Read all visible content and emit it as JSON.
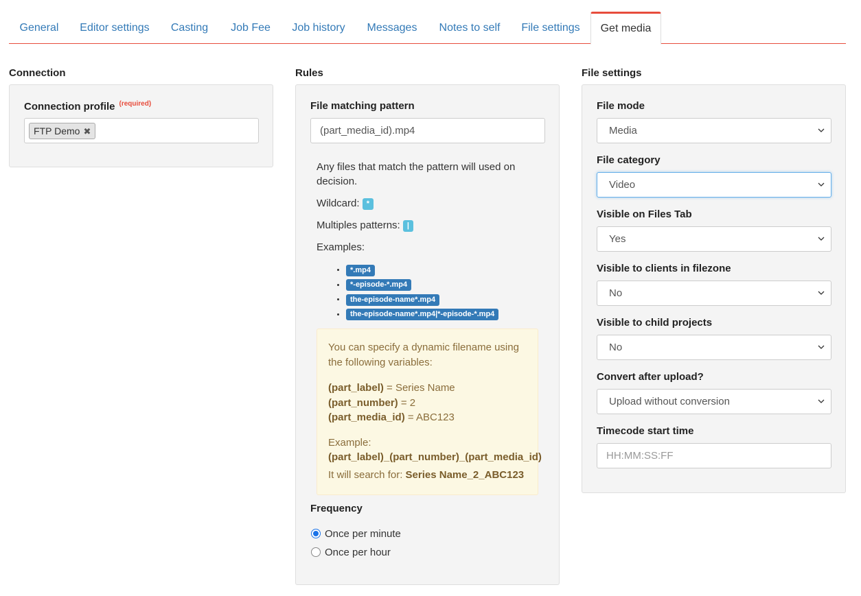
{
  "tabs": [
    {
      "label": "General"
    },
    {
      "label": "Editor settings"
    },
    {
      "label": "Casting"
    },
    {
      "label": "Job Fee"
    },
    {
      "label": "Job history"
    },
    {
      "label": "Messages"
    },
    {
      "label": "Notes to self"
    },
    {
      "label": "File settings"
    },
    {
      "label": "Get media",
      "active": true
    }
  ],
  "connection": {
    "title": "Connection",
    "profile_label": "Connection profile",
    "required": "(required)",
    "selected_tag": "FTP Demo",
    "remove_glyph": "✖"
  },
  "rules": {
    "title": "Rules",
    "pattern_label": "File matching pattern",
    "pattern_value": "(part_media_id).mp4",
    "help_line1": "Any files that match the pattern will used on decision.",
    "wildcard_label": "Wildcard:",
    "wildcard_value": "*",
    "multiple_label": "Multiples patterns:",
    "multiple_value": "|",
    "examples_label": "Examples:",
    "examples": [
      "*.mp4",
      "*-episode-*.mp4",
      "the-episode-name*.mp4",
      "the-episode-name*.mp4|*-episode-*.mp4"
    ],
    "note": {
      "intro": "You can specify a dynamic filename using the following variables:",
      "vars": [
        {
          "name": "(part_label)",
          "value": " = Series Name"
        },
        {
          "name": "(part_number)",
          "value": " = 2"
        },
        {
          "name": "(part_media_id)",
          "value": " = ABC123"
        }
      ],
      "example_label": "Example:",
      "example_value": "(part_label)_(part_number)_(part_media_id)",
      "search_label": "It will search for: ",
      "search_value": "Series Name_2_ABC123"
    },
    "frequency_label": "Frequency",
    "frequency_options": [
      {
        "label": "Once per minute",
        "checked": true
      },
      {
        "label": "Once per hour",
        "checked": false
      }
    ]
  },
  "file_settings": {
    "title": "File settings",
    "fields": [
      {
        "label": "File mode",
        "value": "Media"
      },
      {
        "label": "File category",
        "value": "Video"
      },
      {
        "label": "Visible on Files Tab",
        "value": "Yes"
      },
      {
        "label": "Visible to clients in filezone",
        "value": "No"
      },
      {
        "label": "Visible to child projects",
        "value": "No"
      },
      {
        "label": "Convert after upload?",
        "value": "Upload without conversion"
      }
    ],
    "timecode_label": "Timecode start time",
    "timecode_placeholder": "HH:MM:SS:FF"
  }
}
